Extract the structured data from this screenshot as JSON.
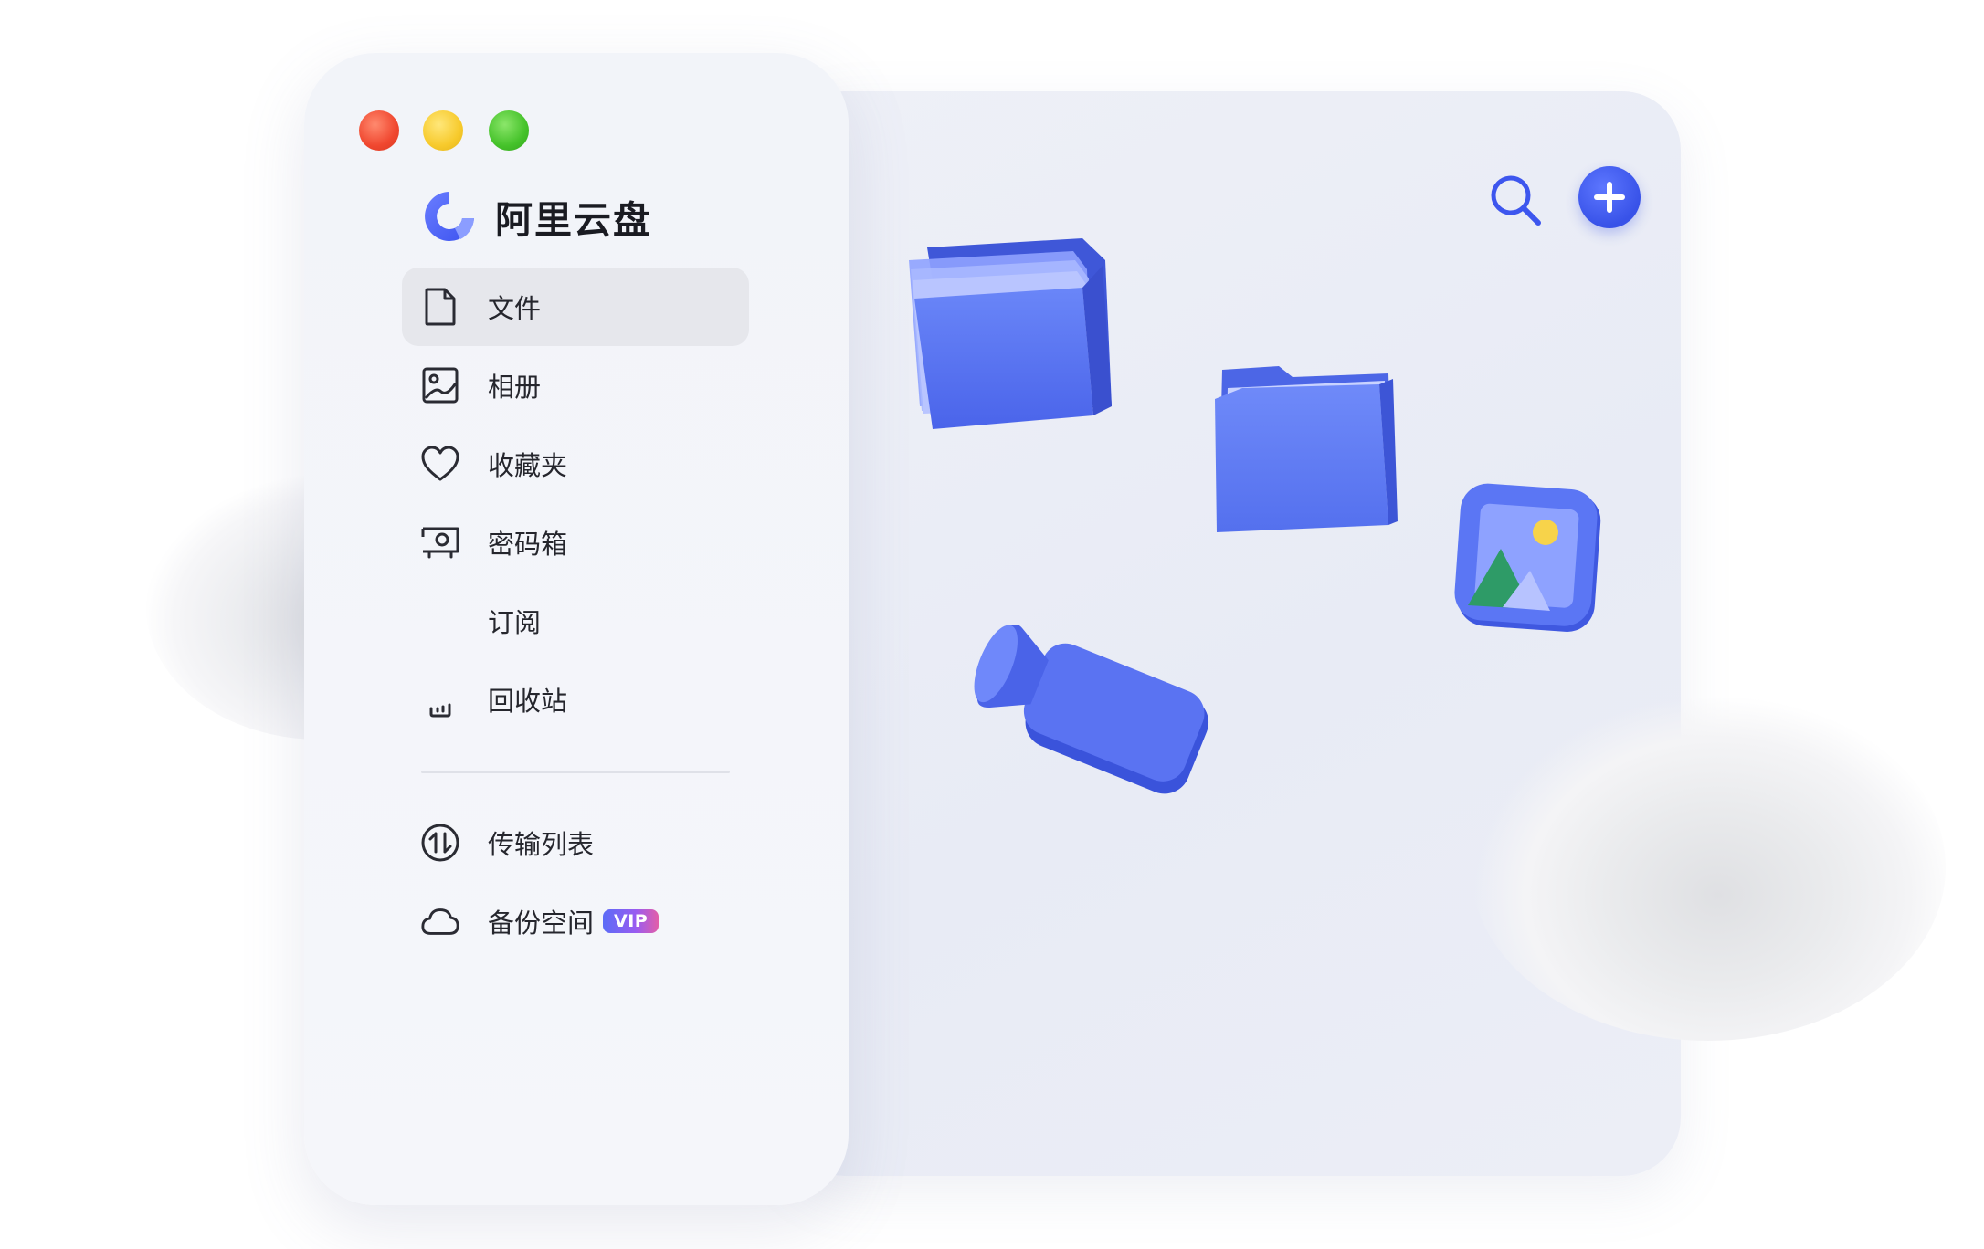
{
  "app": {
    "name": "阿里云盘"
  },
  "window_controls": [
    "close",
    "minimize",
    "maximize"
  ],
  "sidebar": {
    "items": [
      {
        "label": "文件",
        "icon": "file-icon",
        "active": true
      },
      {
        "label": "相册",
        "icon": "album-icon",
        "active": false
      },
      {
        "label": "收藏夹",
        "icon": "heart-icon",
        "active": false
      },
      {
        "label": "密码箱",
        "icon": "safe-icon",
        "active": false
      },
      {
        "label": "订阅",
        "icon": "subscribe-icon",
        "active": false
      },
      {
        "label": "回收站",
        "icon": "trash-icon",
        "active": false
      }
    ],
    "bottom_items": [
      {
        "label": "传输列表",
        "icon": "transfer-icon"
      },
      {
        "label": "备份空间",
        "icon": "cloud-icon",
        "badge": "VIP"
      }
    ]
  },
  "toolbar": {
    "search_icon": "search-icon",
    "add_icon": "plus-icon"
  },
  "colors": {
    "accent": "#3d56ee",
    "folder": "#5473f3",
    "close": "#f0472f",
    "minimize": "#f7ca2c",
    "maximize": "#45c22a"
  }
}
